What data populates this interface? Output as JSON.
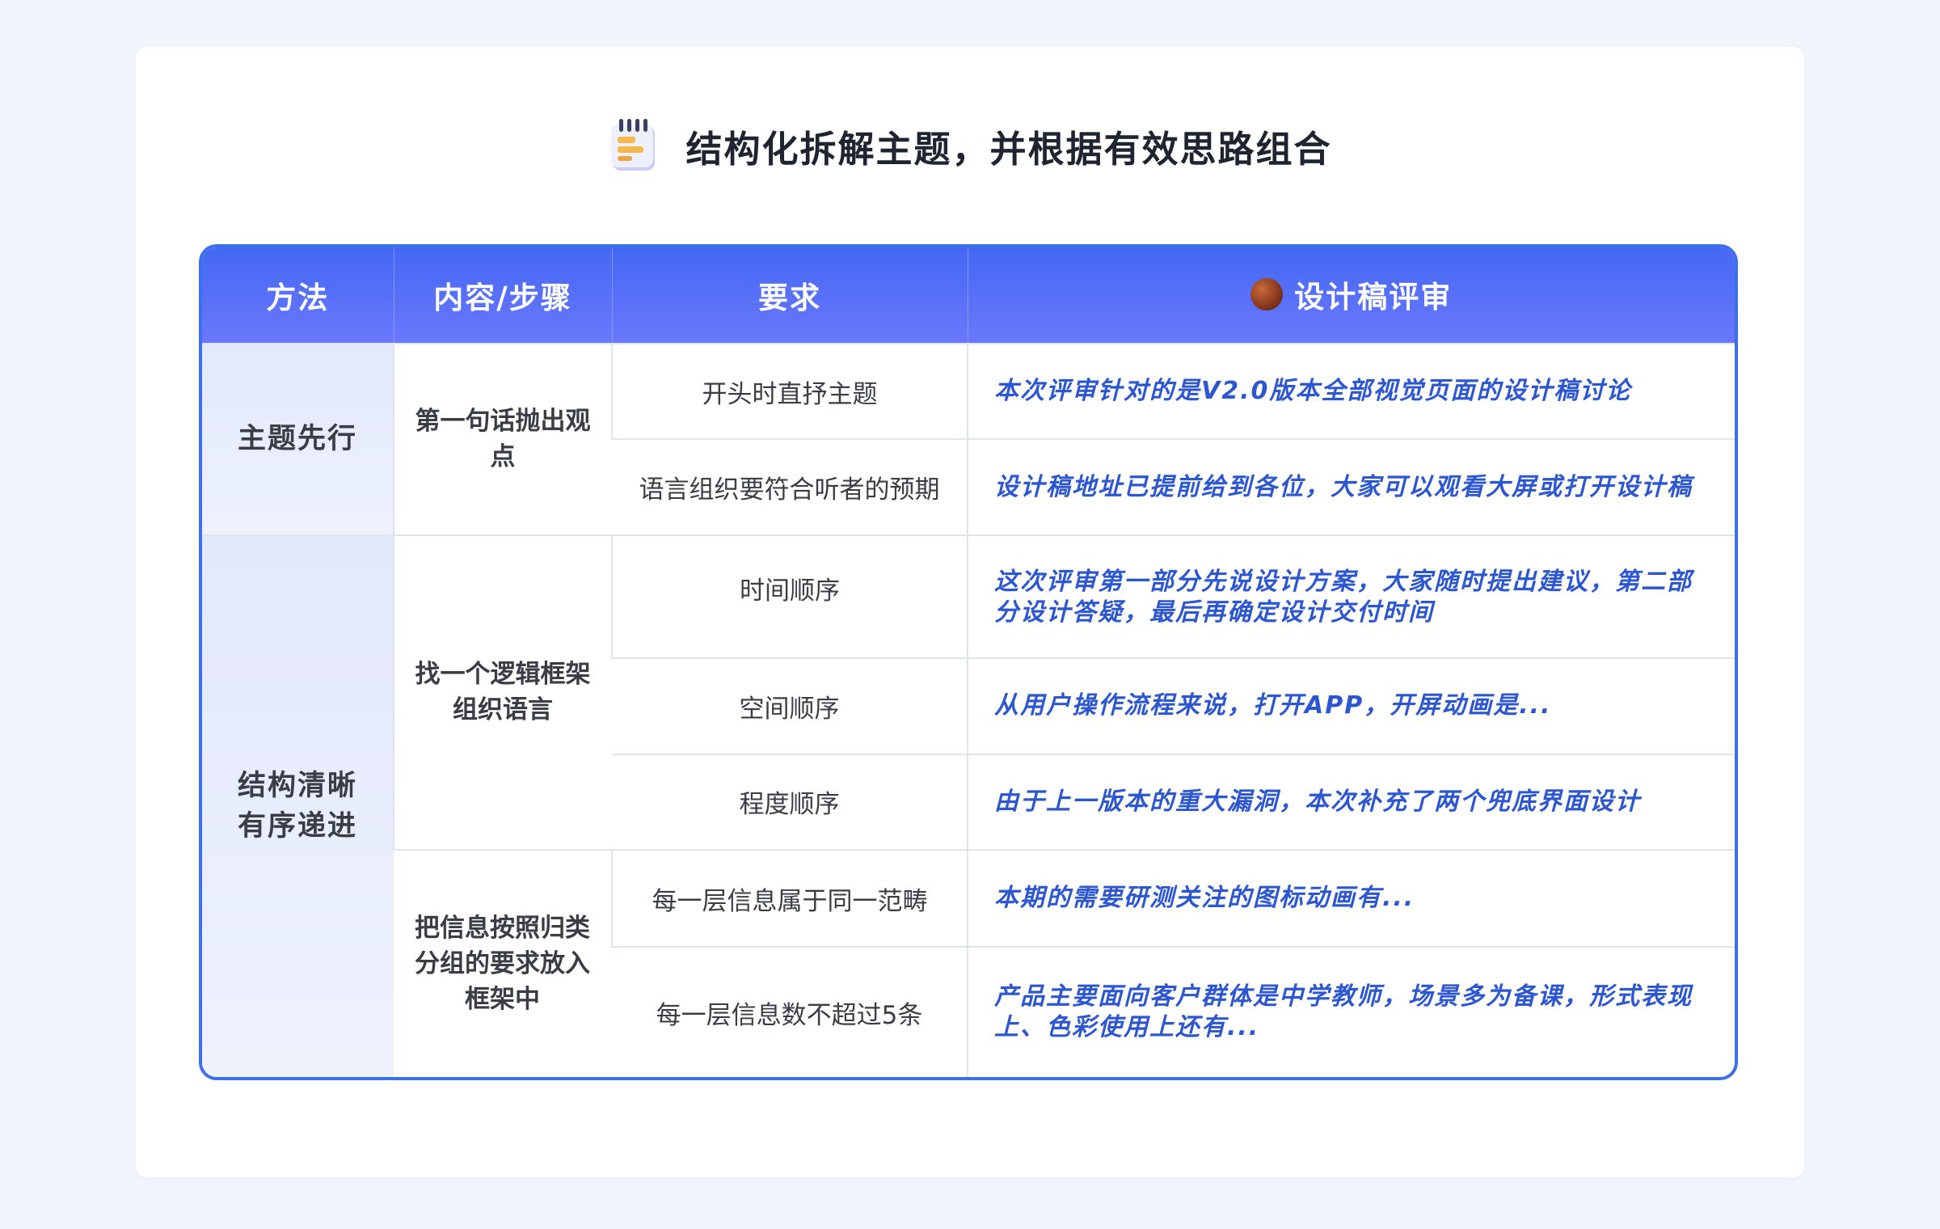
{
  "title": "结构化拆解主题，并根据有效思路组合",
  "table": {
    "headers": [
      "方法",
      "内容/步骤",
      "要求",
      "设计稿评审"
    ],
    "method_1": "主题先行",
    "method_2_lines": [
      "结构清晰",
      "有序递进"
    ],
    "content_1_lines": [
      "第一句话抛出观",
      "点"
    ],
    "content_2_lines": [
      "找一个逻辑框架",
      "组织语言"
    ],
    "content_3_lines": [
      "把信息按照归类",
      "分组的要求放入",
      "框架中"
    ],
    "rows": [
      {
        "requirement": "开头时直抒主题",
        "review_lines": [
          "本次评审针对的是V2.0版本全部视觉页面的设计稿讨论"
        ]
      },
      {
        "requirement": "语言组织要符合听者的预期",
        "review_lines": [
          "设计稿地址已提前给到各位，大家可以观看大屏或打开设计稿"
        ]
      },
      {
        "requirement": "时间顺序",
        "review_lines": [
          "这次评审第一部分先说设计方案，大家随时提出建议，第二部",
          "分设计答疑，最后再确定设计交付时间"
        ]
      },
      {
        "requirement": "空间顺序",
        "review_lines": [
          "从用户操作流程来说，打开APP，开屏动画是..."
        ]
      },
      {
        "requirement": "程度顺序",
        "review_lines": [
          "由于上一版本的重大漏洞，本次补充了两个兜底界面设计"
        ]
      },
      {
        "requirement": "每一层信息属于同一范畴",
        "review_lines": [
          "本期的需要研测关注的图标动画有..."
        ]
      },
      {
        "requirement": "每一层信息数不超过5条",
        "review_lines": [
          "产品主要面向客户群体是中学教师，场景多为备课，形式表现",
          "上、色彩使用上还有..."
        ]
      }
    ]
  },
  "colors": {
    "header_gradient_start": "#4468f3",
    "header_gradient_end": "#6a78fb",
    "table_border": "#3d6fe8",
    "review_text": "#2c57cf",
    "method_bg": "#e3e8fc"
  },
  "icons": {
    "title": "notepad-icon",
    "header": "avatar-icon"
  }
}
